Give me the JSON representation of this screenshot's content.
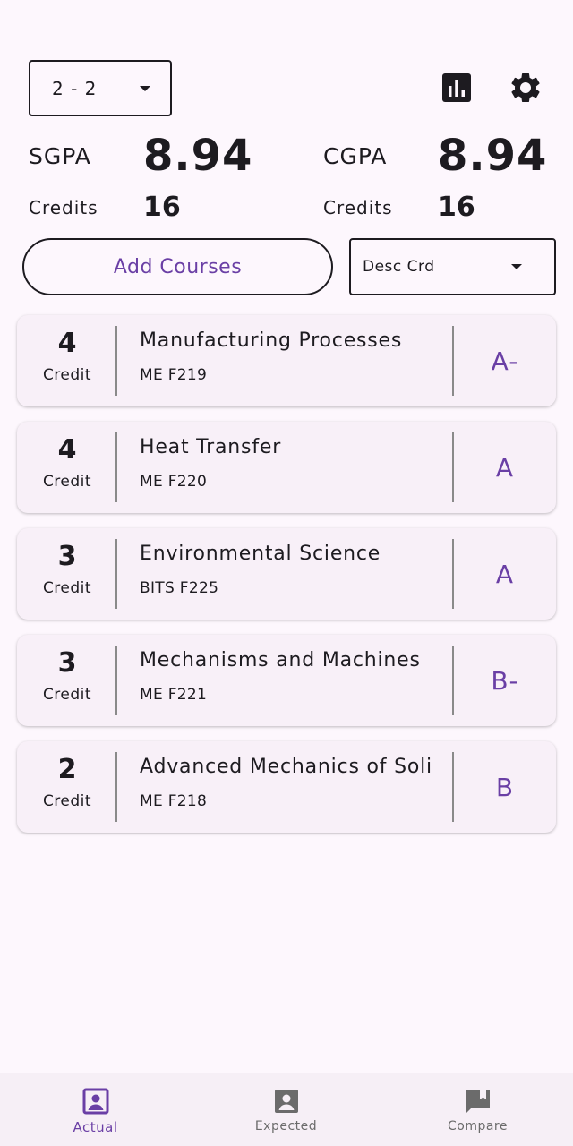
{
  "semester": {
    "value": "2 - 2"
  },
  "header_icons": {
    "stats": "bar-chart-icon",
    "settings": "gear-icon"
  },
  "summary": {
    "sgpa_label": "SGPA",
    "sgpa_value": "8.94",
    "cgpa_label": "CGPA",
    "cgpa_value": "8.94",
    "credits_label_left": "Credits",
    "credits_left": "16",
    "credits_label_right": "Credits",
    "credits_right": "16"
  },
  "actions": {
    "add_courses": "Add Courses",
    "sort_value": "Desc Crd"
  },
  "courses": [
    {
      "credit": "4",
      "credit_label": "Credit",
      "name": "Manufacturing Processes",
      "code": "ME F219",
      "grade": "A-"
    },
    {
      "credit": "4",
      "credit_label": "Credit",
      "name": "Heat Transfer",
      "code": "ME F220",
      "grade": "A"
    },
    {
      "credit": "3",
      "credit_label": "Credit",
      "name": "Environmental Science",
      "code": "BITS F225",
      "grade": "A"
    },
    {
      "credit": "3",
      "credit_label": "Credit",
      "name": "Mechanisms and Machines",
      "code": "ME F221",
      "grade": "B-"
    },
    {
      "credit": "2",
      "credit_label": "Credit",
      "name": "Advanced Mechanics of Solids",
      "code": "ME F218",
      "grade": "B"
    }
  ],
  "nav": [
    {
      "label": "Actual",
      "icon": "account-box-icon",
      "active": true
    },
    {
      "label": "Expected",
      "icon": "person-card-icon",
      "active": false
    },
    {
      "label": "Compare",
      "icon": "bookmark-chat-icon",
      "active": false
    }
  ],
  "colors": {
    "accent": "#6a3fa5",
    "background": "#fdf7fd",
    "card": "#f8f0f8",
    "text": "#1d1b20"
  }
}
